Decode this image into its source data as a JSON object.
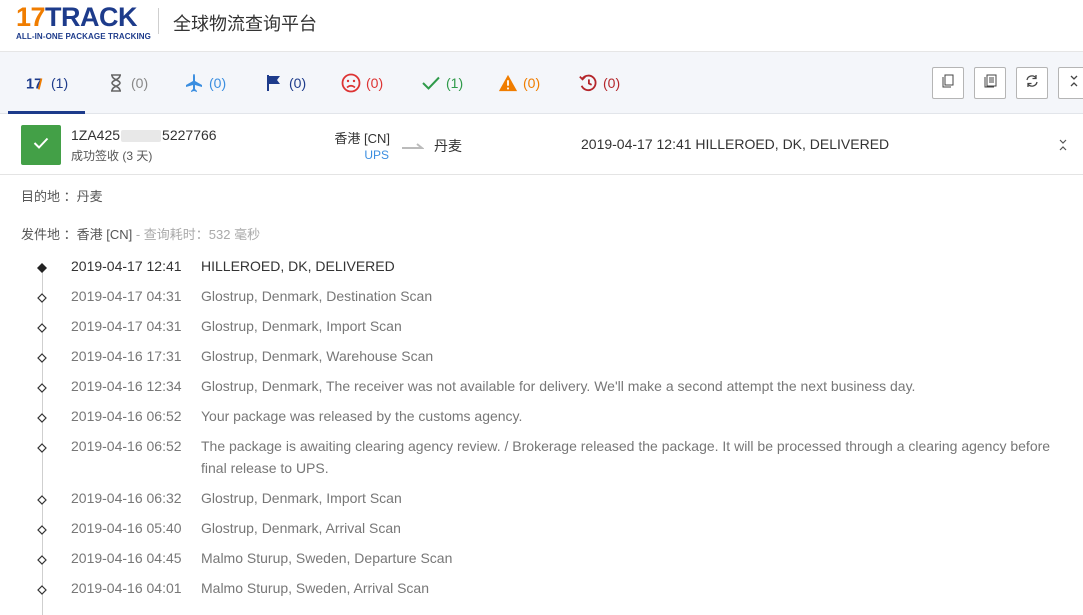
{
  "header": {
    "logo_main_num": "17",
    "logo_main_text": "TRACK",
    "logo_sub": "ALL-IN-ONE PACKAGE TRACKING",
    "title": "全球物流查询平台"
  },
  "tabs": [
    {
      "icon": "17track-logo-icon",
      "count": "(1)"
    },
    {
      "icon": "hourglass-icon",
      "count": "(0)"
    },
    {
      "icon": "airplane-icon",
      "count": "(0)"
    },
    {
      "icon": "flag-icon",
      "count": "(0)"
    },
    {
      "icon": "sad-face-icon",
      "count": "(0)"
    },
    {
      "icon": "checkmark-icon",
      "count": "(1)"
    },
    {
      "icon": "warning-icon",
      "count": "(0)"
    },
    {
      "icon": "history-icon",
      "count": "(0)"
    }
  ],
  "toolbar": {
    "buttons": [
      "copy-icon",
      "copy-list-icon",
      "refresh-icon",
      "collapse-icon"
    ]
  },
  "shipment": {
    "tracking_prefix": "1ZA425",
    "tracking_suffix": "5227766",
    "status": "成功签收 (3 天)",
    "origin": "香港 [CN]",
    "carrier": "UPS",
    "destination": "丹麦",
    "latest_event": "2019-04-17 12:41  HILLEROED, DK, DELIVERED",
    "status_color": "#43a047"
  },
  "details": {
    "destination_line": "目的地 ：丹麦",
    "origin_line": "发件地 ：香港 [CN]",
    "query_time": " - 查询耗时：532 毫秒"
  },
  "events": [
    {
      "time": "2019-04-17 12:41",
      "desc": "HILLEROED, DK, DELIVERED"
    },
    {
      "time": "2019-04-17 04:31",
      "desc": "Glostrup, Denmark, Destination Scan"
    },
    {
      "time": "2019-04-17 04:31",
      "desc": "Glostrup, Denmark, Import Scan"
    },
    {
      "time": "2019-04-16 17:31",
      "desc": "Glostrup, Denmark, Warehouse Scan"
    },
    {
      "time": "2019-04-16 12:34",
      "desc": "Glostrup, Denmark, The receiver was not available for delivery. We'll make a second attempt the next business day."
    },
    {
      "time": "2019-04-16 06:52",
      "desc": "Your package was released by the customs agency."
    },
    {
      "time": "2019-04-16 06:52",
      "desc": "The package is awaiting clearing agency review. / Brokerage released the package. It will be processed through a clearing agency before final release to UPS."
    },
    {
      "time": "2019-04-16 06:32",
      "desc": "Glostrup, Denmark, Import Scan"
    },
    {
      "time": "2019-04-16 05:40",
      "desc": "Glostrup, Denmark, Arrival Scan"
    },
    {
      "time": "2019-04-16 04:45",
      "desc": "Malmo Sturup, Sweden, Departure Scan"
    },
    {
      "time": "2019-04-16 04:01",
      "desc": "Malmo Sturup, Sweden, Arrival Scan"
    }
  ]
}
